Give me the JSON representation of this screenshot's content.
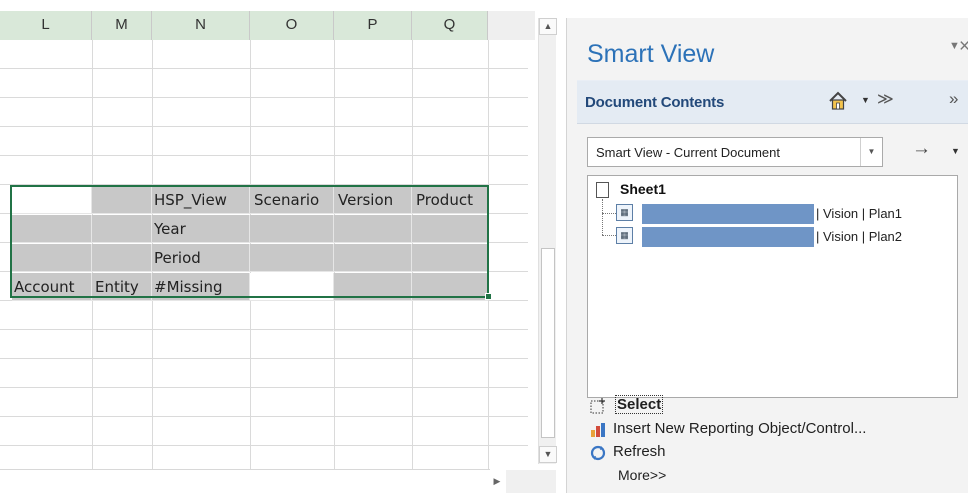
{
  "spreadsheet": {
    "columns": [
      "L",
      "M",
      "N",
      "O",
      "P",
      "Q"
    ],
    "grid_rows": [
      [
        "",
        "",
        "HSP_View",
        "Scenario",
        "Version",
        "Product"
      ],
      [
        "",
        "",
        "Year",
        "",
        "",
        ""
      ],
      [
        "",
        "",
        "Period",
        "",
        "",
        ""
      ],
      [
        "Account",
        "Entity",
        "#Missing",
        "",
        "",
        ""
      ]
    ]
  },
  "smart_view": {
    "title": "Smart View",
    "section_title": "Document Contents",
    "source_selector": "Smart View - Current Document",
    "tree": {
      "root": "Sheet1",
      "items": [
        {
          "label": "| Vision | Plan1"
        },
        {
          "label": "| Vision | Plan2"
        }
      ]
    },
    "actions": {
      "select": "Select",
      "insert": "Insert New Reporting Object/Control...",
      "refresh": "Refresh",
      "more": "More>>"
    }
  },
  "icons": {
    "home": "home-icon",
    "dropdown": "dropdown-arrow-icon",
    "collapse": "double-chevron-down-icon",
    "expand": "double-chevron-right-icon",
    "go": "arrow-right-icon",
    "close": "close-icon",
    "refresh": "refresh-icon"
  },
  "colors": {
    "smart_view_title": "#2c72b8",
    "selection_border": "#217346",
    "tree_highlight": "#6f95c6",
    "section_title": "#23497a"
  }
}
